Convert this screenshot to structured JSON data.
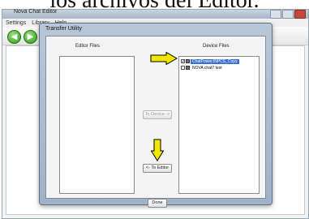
{
  "caption": "los archivos del Editor.",
  "app": {
    "title": "Nova Chat Editor",
    "menu": [
      "Settings",
      "Library",
      "Help"
    ],
    "nav": {
      "back": "◀",
      "forward": "▶"
    }
  },
  "dialog": {
    "title": "Transfer Utility",
    "editor_files_label": "Editor Files",
    "device_files_label": "Device Files",
    "to_device_label": "To Device ->",
    "to_editor_label": "<- To Editor",
    "done_label": "Done",
    "device_files": [
      {
        "name": "ChatPower.INPCS_Copy",
        "checked": true,
        "selected": true
      },
      {
        "name": "NOVA chat7 test",
        "checked": false,
        "selected": false
      }
    ]
  },
  "colors": {
    "highlight_arrow": "#f2e600",
    "selection": "#3a6fd4"
  }
}
